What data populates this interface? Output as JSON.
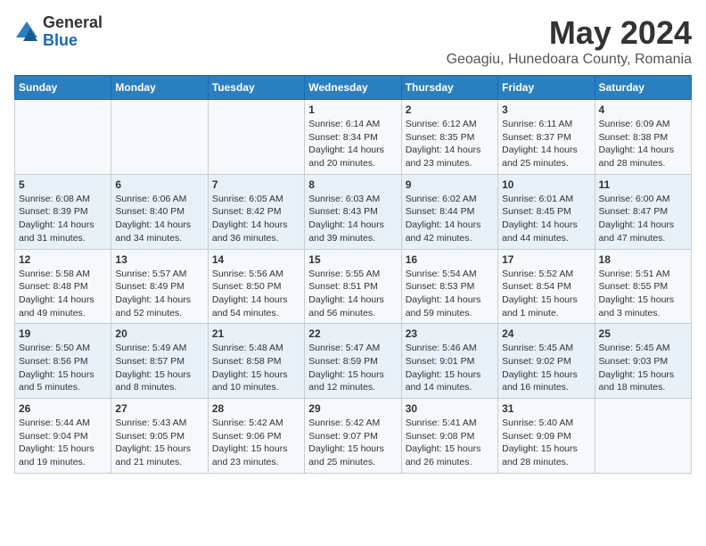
{
  "header": {
    "logo_general": "General",
    "logo_blue": "Blue",
    "title": "May 2024",
    "subtitle": "Geoagiu, Hunedoara County, Romania"
  },
  "days_of_week": [
    "Sunday",
    "Monday",
    "Tuesday",
    "Wednesday",
    "Thursday",
    "Friday",
    "Saturday"
  ],
  "weeks": [
    [
      {
        "num": "",
        "info": ""
      },
      {
        "num": "",
        "info": ""
      },
      {
        "num": "",
        "info": ""
      },
      {
        "num": "1",
        "info": "Sunrise: 6:14 AM\nSunset: 8:34 PM\nDaylight: 14 hours\nand 20 minutes."
      },
      {
        "num": "2",
        "info": "Sunrise: 6:12 AM\nSunset: 8:35 PM\nDaylight: 14 hours\nand 23 minutes."
      },
      {
        "num": "3",
        "info": "Sunrise: 6:11 AM\nSunset: 8:37 PM\nDaylight: 14 hours\nand 25 minutes."
      },
      {
        "num": "4",
        "info": "Sunrise: 6:09 AM\nSunset: 8:38 PM\nDaylight: 14 hours\nand 28 minutes."
      }
    ],
    [
      {
        "num": "5",
        "info": "Sunrise: 6:08 AM\nSunset: 8:39 PM\nDaylight: 14 hours\nand 31 minutes."
      },
      {
        "num": "6",
        "info": "Sunrise: 6:06 AM\nSunset: 8:40 PM\nDaylight: 14 hours\nand 34 minutes."
      },
      {
        "num": "7",
        "info": "Sunrise: 6:05 AM\nSunset: 8:42 PM\nDaylight: 14 hours\nand 36 minutes."
      },
      {
        "num": "8",
        "info": "Sunrise: 6:03 AM\nSunset: 8:43 PM\nDaylight: 14 hours\nand 39 minutes."
      },
      {
        "num": "9",
        "info": "Sunrise: 6:02 AM\nSunset: 8:44 PM\nDaylight: 14 hours\nand 42 minutes."
      },
      {
        "num": "10",
        "info": "Sunrise: 6:01 AM\nSunset: 8:45 PM\nDaylight: 14 hours\nand 44 minutes."
      },
      {
        "num": "11",
        "info": "Sunrise: 6:00 AM\nSunset: 8:47 PM\nDaylight: 14 hours\nand 47 minutes."
      }
    ],
    [
      {
        "num": "12",
        "info": "Sunrise: 5:58 AM\nSunset: 8:48 PM\nDaylight: 14 hours\nand 49 minutes."
      },
      {
        "num": "13",
        "info": "Sunrise: 5:57 AM\nSunset: 8:49 PM\nDaylight: 14 hours\nand 52 minutes."
      },
      {
        "num": "14",
        "info": "Sunrise: 5:56 AM\nSunset: 8:50 PM\nDaylight: 14 hours\nand 54 minutes."
      },
      {
        "num": "15",
        "info": "Sunrise: 5:55 AM\nSunset: 8:51 PM\nDaylight: 14 hours\nand 56 minutes."
      },
      {
        "num": "16",
        "info": "Sunrise: 5:54 AM\nSunset: 8:53 PM\nDaylight: 14 hours\nand 59 minutes."
      },
      {
        "num": "17",
        "info": "Sunrise: 5:52 AM\nSunset: 8:54 PM\nDaylight: 15 hours\nand 1 minute."
      },
      {
        "num": "18",
        "info": "Sunrise: 5:51 AM\nSunset: 8:55 PM\nDaylight: 15 hours\nand 3 minutes."
      }
    ],
    [
      {
        "num": "19",
        "info": "Sunrise: 5:50 AM\nSunset: 8:56 PM\nDaylight: 15 hours\nand 5 minutes."
      },
      {
        "num": "20",
        "info": "Sunrise: 5:49 AM\nSunset: 8:57 PM\nDaylight: 15 hours\nand 8 minutes."
      },
      {
        "num": "21",
        "info": "Sunrise: 5:48 AM\nSunset: 8:58 PM\nDaylight: 15 hours\nand 10 minutes."
      },
      {
        "num": "22",
        "info": "Sunrise: 5:47 AM\nSunset: 8:59 PM\nDaylight: 15 hours\nand 12 minutes."
      },
      {
        "num": "23",
        "info": "Sunrise: 5:46 AM\nSunset: 9:01 PM\nDaylight: 15 hours\nand 14 minutes."
      },
      {
        "num": "24",
        "info": "Sunrise: 5:45 AM\nSunset: 9:02 PM\nDaylight: 15 hours\nand 16 minutes."
      },
      {
        "num": "25",
        "info": "Sunrise: 5:45 AM\nSunset: 9:03 PM\nDaylight: 15 hours\nand 18 minutes."
      }
    ],
    [
      {
        "num": "26",
        "info": "Sunrise: 5:44 AM\nSunset: 9:04 PM\nDaylight: 15 hours\nand 19 minutes."
      },
      {
        "num": "27",
        "info": "Sunrise: 5:43 AM\nSunset: 9:05 PM\nDaylight: 15 hours\nand 21 minutes."
      },
      {
        "num": "28",
        "info": "Sunrise: 5:42 AM\nSunset: 9:06 PM\nDaylight: 15 hours\nand 23 minutes."
      },
      {
        "num": "29",
        "info": "Sunrise: 5:42 AM\nSunset: 9:07 PM\nDaylight: 15 hours\nand 25 minutes."
      },
      {
        "num": "30",
        "info": "Sunrise: 5:41 AM\nSunset: 9:08 PM\nDaylight: 15 hours\nand 26 minutes."
      },
      {
        "num": "31",
        "info": "Sunrise: 5:40 AM\nSunset: 9:09 PM\nDaylight: 15 hours\nand 28 minutes."
      },
      {
        "num": "",
        "info": ""
      }
    ]
  ]
}
